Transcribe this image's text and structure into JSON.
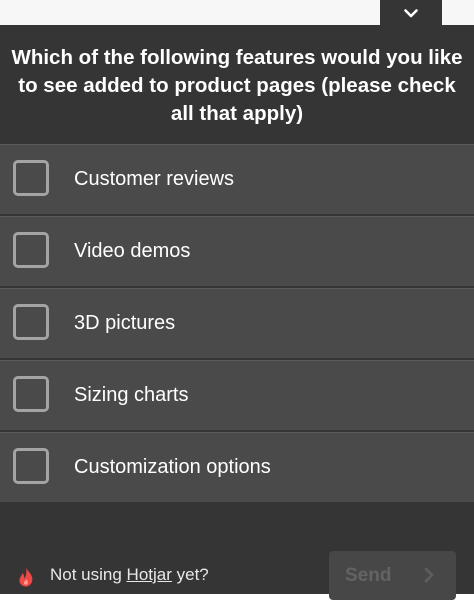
{
  "survey": {
    "question": "Which of the following features would you like to see added to product pages (please check all that apply)",
    "options": [
      {
        "label": "Customer reviews",
        "checked": false
      },
      {
        "label": "Video demos",
        "checked": false
      },
      {
        "label": "3D pictures",
        "checked": false
      },
      {
        "label": "Sizing charts",
        "checked": false
      },
      {
        "label": "Customization options",
        "checked": false
      }
    ]
  },
  "footer": {
    "prefix": "Not using ",
    "link_label": "Hotjar",
    "suffix": " yet?",
    "send_label": "Send"
  },
  "icons": {
    "collapse": "chevron-down-icon",
    "brand": "flame-icon",
    "send": "chevron-right-icon"
  },
  "colors": {
    "panel": "#353535",
    "option_bg": "#4a4a4a",
    "flame": "#f04747",
    "button_bg": "#474747"
  }
}
